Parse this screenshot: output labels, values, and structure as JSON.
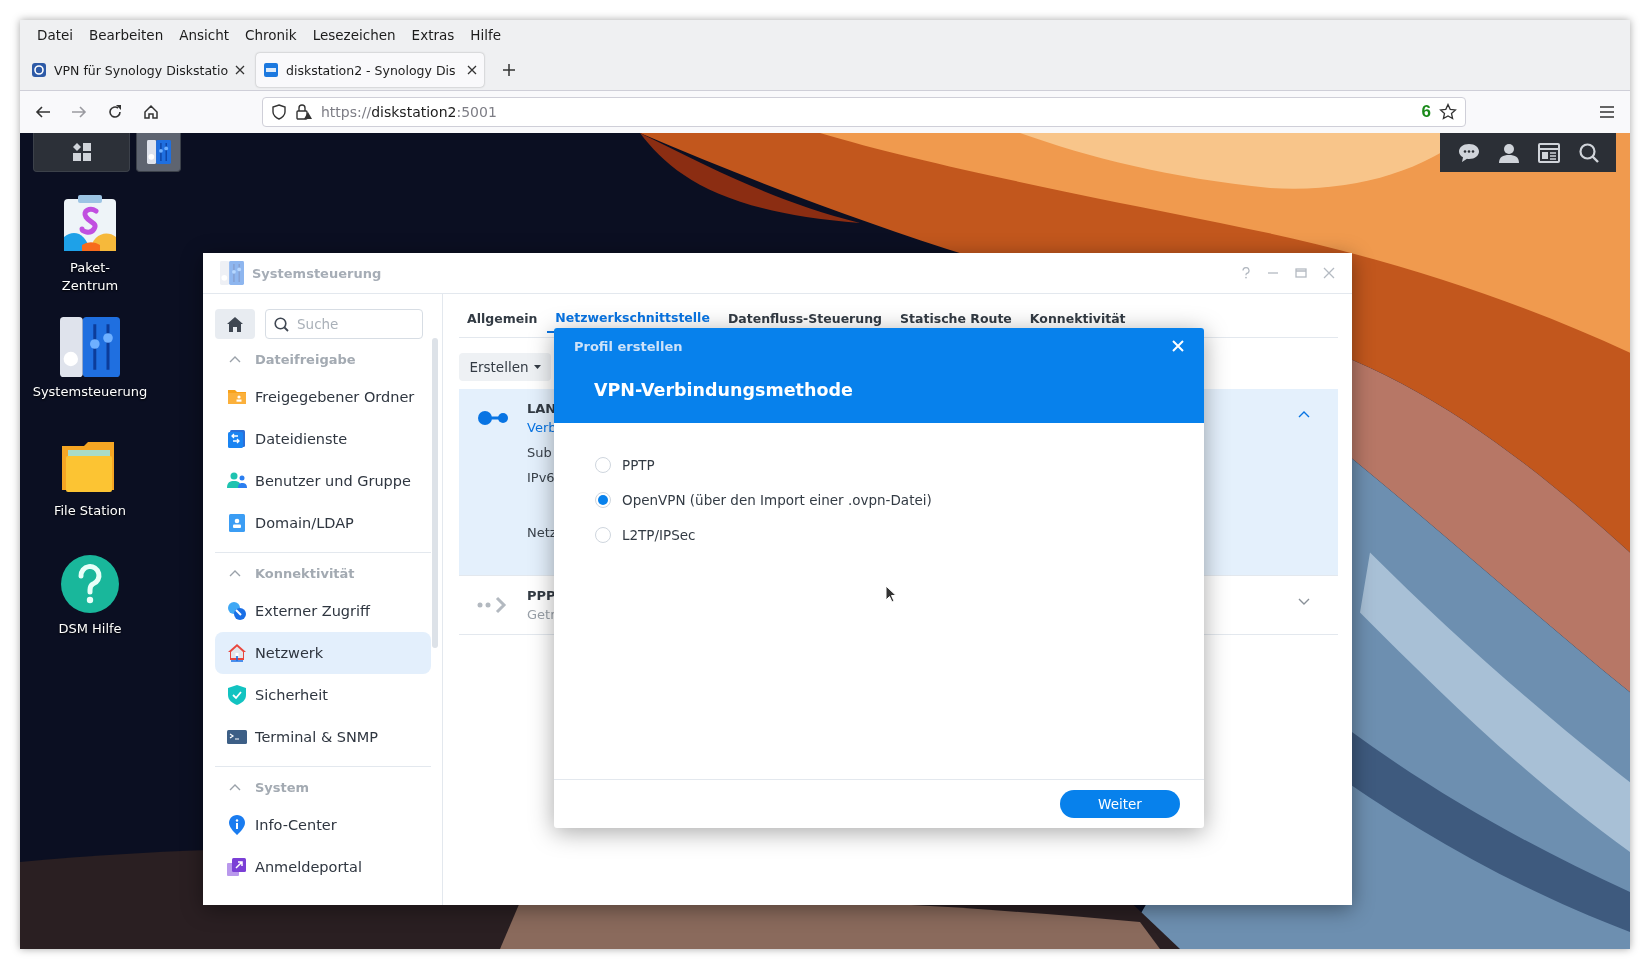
{
  "browser": {
    "menu": [
      "Datei",
      "Bearbeiten",
      "Ansicht",
      "Chronik",
      "Lesezeichen",
      "Extras",
      "Hilfe"
    ],
    "tabs": [
      {
        "title": "VPN für Synology Diskstatio",
        "selected": false
      },
      {
        "title": "diskstation2 - Synology Dis",
        "selected": true
      }
    ],
    "url": {
      "scheme": "https://",
      "host": "diskstation2",
      "port": ":5001"
    },
    "badge": "6"
  },
  "desktop": {
    "icons": [
      {
        "label_lines": [
          "Paket-",
          "Zentrum"
        ]
      },
      {
        "label_lines": [
          "Systemsteuerung"
        ]
      },
      {
        "label_lines": [
          "File Station"
        ]
      },
      {
        "label_lines": [
          "DSM Hilfe"
        ]
      }
    ]
  },
  "window": {
    "title": "Systemsteuerung",
    "search": {
      "placeholder": "Suche"
    },
    "sidebar": [
      {
        "group": "Dateifreigabe",
        "expanded": true,
        "items": [
          {
            "label": "Freigegebener Ordner",
            "selected": false
          },
          {
            "label": "Dateidienste",
            "selected": false
          },
          {
            "label": "Benutzer und Gruppe",
            "selected": false
          },
          {
            "label": "Domain/LDAP",
            "selected": false
          }
        ]
      },
      {
        "group": "Konnektivität",
        "expanded": true,
        "items": [
          {
            "label": "Externer Zugriff",
            "selected": false
          },
          {
            "label": "Netzwerk",
            "selected": true
          },
          {
            "label": "Sicherheit",
            "selected": false
          },
          {
            "label": "Terminal & SNMP",
            "selected": false
          }
        ]
      },
      {
        "group": "System",
        "expanded": true,
        "items": [
          {
            "label": "Info-Center",
            "selected": false
          },
          {
            "label": "Anmeldeportal",
            "selected": false
          }
        ]
      }
    ],
    "tabs": [
      {
        "label": "Allgemein",
        "selected": false
      },
      {
        "label": "Netzwerkschnittstelle",
        "selected": true
      },
      {
        "label": "Datenfluss-Steuerung",
        "selected": false
      },
      {
        "label": "Statische Route",
        "selected": false
      },
      {
        "label": "Konnektivität",
        "selected": false
      }
    ],
    "create_button": "Erstellen",
    "interfaces": [
      {
        "name": "LAN",
        "status": "Verb",
        "connected": true,
        "expanded": true,
        "details": [
          "Sub",
          "IPv6",
          "Netz"
        ]
      },
      {
        "name": "PPP",
        "status": "Getr",
        "connected": false,
        "expanded": false
      }
    ]
  },
  "dialog": {
    "header": "Profil erstellen",
    "title": "VPN-Verbindungsmethode",
    "options": [
      {
        "label": "PPTP",
        "selected": false
      },
      {
        "label": "OpenVPN (über den Import einer .ovpn-Datei)",
        "selected": true
      },
      {
        "label": "L2TP/IPSec",
        "selected": false
      }
    ],
    "next_button": "Weiter"
  }
}
